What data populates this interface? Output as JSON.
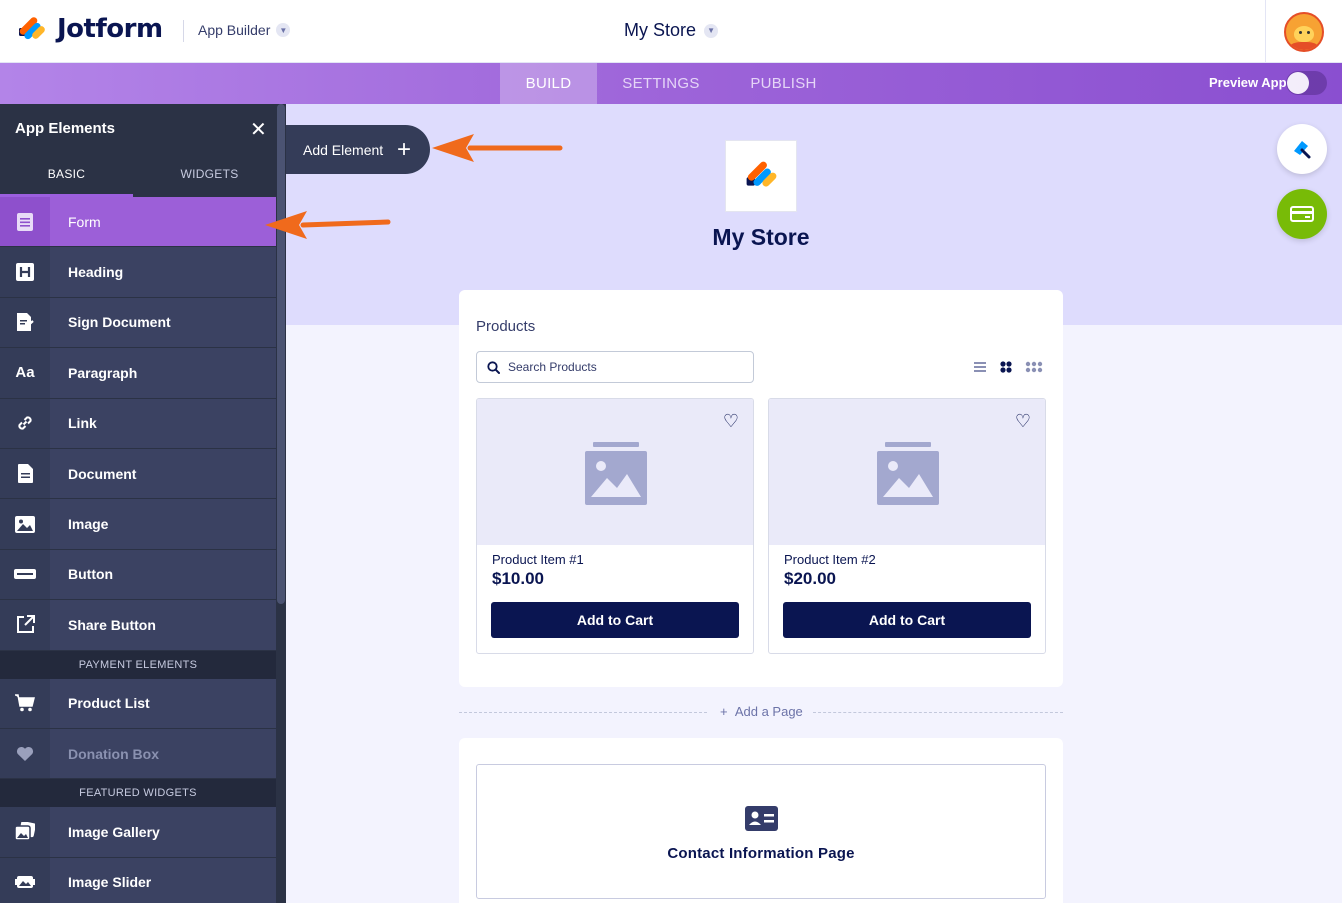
{
  "header": {
    "brand": "Jotform",
    "app_builder_label": "App Builder",
    "store_title": "My Store"
  },
  "nav": {
    "tabs": [
      {
        "label": "BUILD",
        "active": true
      },
      {
        "label": "SETTINGS",
        "active": false
      },
      {
        "label": "PUBLISH",
        "active": false
      }
    ],
    "preview_label": "Preview App",
    "preview_enabled": false
  },
  "sidebar": {
    "title": "App Elements",
    "tabs": [
      {
        "label": "BASIC",
        "active": true
      },
      {
        "label": "WIDGETS",
        "active": false
      }
    ],
    "items": [
      {
        "label": "Form",
        "icon": "form-icon",
        "active": true
      },
      {
        "label": "Heading",
        "icon": "heading-icon"
      },
      {
        "label": "Sign Document",
        "icon": "sign-document-icon"
      },
      {
        "label": "Paragraph",
        "icon": "paragraph-icon"
      },
      {
        "label": "Link",
        "icon": "link-icon"
      },
      {
        "label": "Document",
        "icon": "document-icon"
      },
      {
        "label": "Image",
        "icon": "image-icon"
      },
      {
        "label": "Button",
        "icon": "button-icon"
      },
      {
        "label": "Share Button",
        "icon": "share-icon"
      }
    ],
    "payment_section": "PAYMENT ELEMENTS",
    "payment_items": [
      {
        "label": "Product List",
        "icon": "cart-icon"
      },
      {
        "label": "Donation Box",
        "icon": "heart-icon",
        "disabled": true
      }
    ],
    "featured_section": "FEATURED WIDGETS",
    "featured_items": [
      {
        "label": "Image Gallery",
        "icon": "image-gallery-icon"
      },
      {
        "label": "Image Slider",
        "icon": "image-slider-icon"
      }
    ],
    "add_element_label": "Add Element"
  },
  "canvas": {
    "app_name": "My Store",
    "products_title": "Products",
    "search_placeholder": "Search Products",
    "products": [
      {
        "name": "Product Item #1",
        "price": "$10.00",
        "button": "Add to Cart"
      },
      {
        "name": "Product Item #2",
        "price": "$20.00",
        "button": "Add to Cart"
      }
    ],
    "add_page_label": "Add a Page",
    "contact_page_label": "Contact Information Page"
  },
  "colors": {
    "navy": "#0a1551",
    "purple": "#9c5fd8",
    "sidebar": "#343c58",
    "hero": "#dedcfd",
    "green": "#78bb07",
    "arrow": "#f06a1c"
  }
}
